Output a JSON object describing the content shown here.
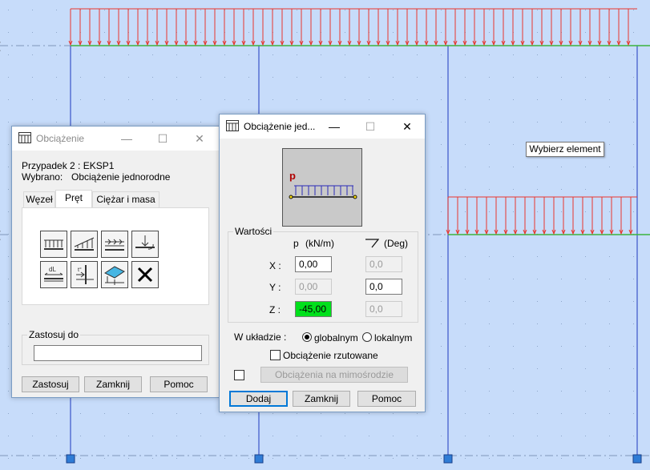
{
  "colors": {
    "background": "#c7dcfa",
    "grid": "#8fa7c9",
    "load": "#e8362e",
    "beam_green": "#3cb43c",
    "column": "#3a55c8",
    "support": "#2f7cd6"
  },
  "tooltip": {
    "text": "Wybierz element"
  },
  "dialog_left": {
    "title": "Obciążenie",
    "case_line": "Przypadek 2 : EKSP1",
    "selected_label": "Wybrano:",
    "selected_value": "Obciążenie jednorodne",
    "tabs": [
      {
        "label": "Węzeł"
      },
      {
        "label": "Pręt"
      },
      {
        "label": "Ciężar i masa"
      }
    ],
    "active_tab": "Pręt",
    "tools": [
      "uniform-load-icon",
      "trapezoidal-load-icon",
      "point-loads-icon",
      "moment-load-icon",
      "dilatation-icon",
      "force-on-bar-icon",
      "surface-load-icon",
      "delete-icon"
    ],
    "apply_to_label": "Zastosuj do",
    "apply_to_value": "",
    "buttons": {
      "apply": "Zastosuj",
      "close": "Zamknij",
      "help": "Pomoc"
    }
  },
  "dialog_right": {
    "title": "Obciążenie jed...",
    "preview_symbol": "p",
    "values_group": "Wartości",
    "col_p_header": "p",
    "col_p_unit": "(kN/m)",
    "col_angle_unit": "(Deg)",
    "rows": [
      {
        "label": "X :",
        "p": "0,00",
        "angle": "0,0",
        "p_enabled": true,
        "angle_enabled": false
      },
      {
        "label": "Y :",
        "p": "0,00",
        "angle": "0,0",
        "p_enabled": false,
        "angle_enabled": true
      },
      {
        "label": "Z :",
        "p": "-45,00",
        "angle": "0,0",
        "p_enabled": true,
        "angle_enabled": false
      }
    ],
    "system_label": "W układzie :",
    "system_options": [
      {
        "label": "globalnym",
        "selected": true
      },
      {
        "label": "lokalnym",
        "selected": false
      }
    ],
    "projected_label": "Obciążenie rzutowane",
    "eccentric_button": "Obciążenia na mimośrodzie",
    "buttons": {
      "add": "Dodaj",
      "close": "Zamknij",
      "help": "Pomoc"
    }
  }
}
